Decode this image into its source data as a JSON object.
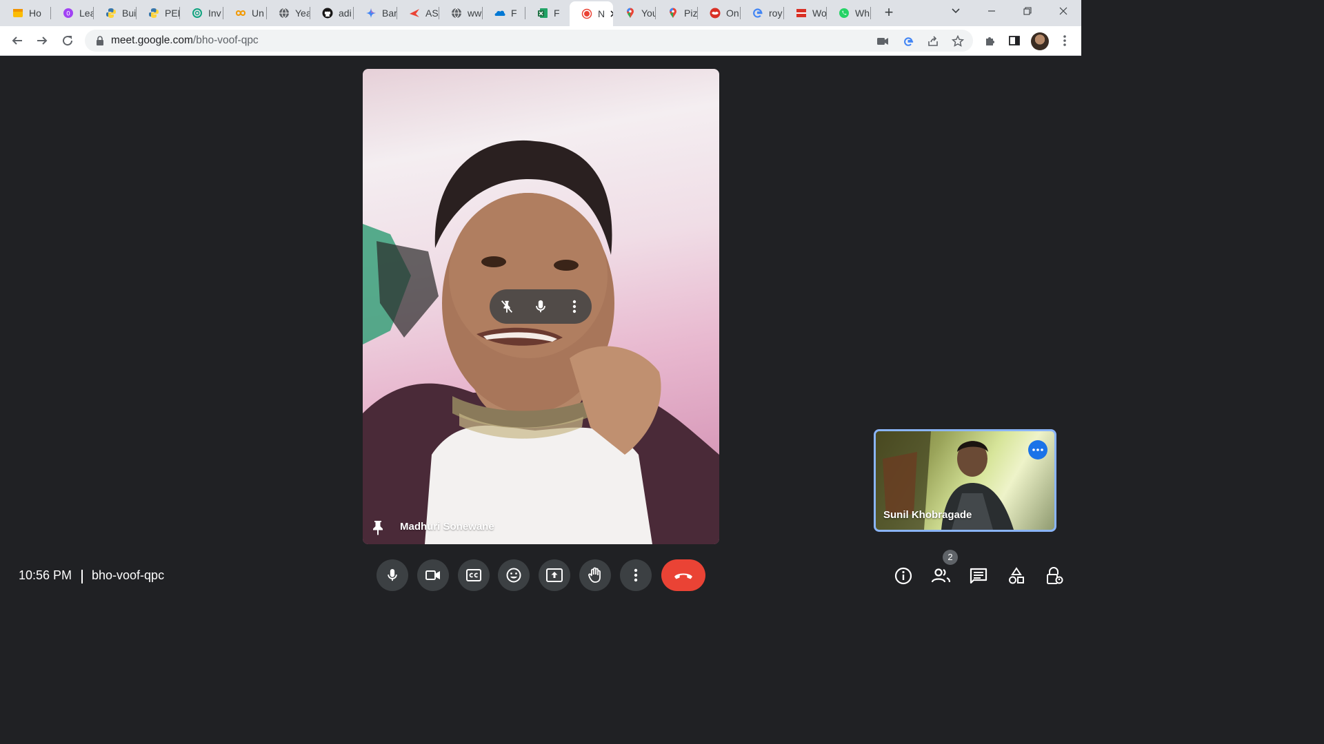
{
  "browser": {
    "tabs": [
      {
        "label": "Ho",
        "icon": "note-icon",
        "color": "#fbbc04"
      },
      {
        "label": "Lea",
        "icon": "leaf-icon",
        "color": "#a142f4"
      },
      {
        "label": "Bui",
        "icon": "python-icon",
        "color": "#3776ab"
      },
      {
        "label": "PEF",
        "icon": "python-icon",
        "color": "#3776ab"
      },
      {
        "label": "Inv",
        "icon": "openai-icon",
        "color": "#10a37f"
      },
      {
        "label": "Un",
        "icon": "infinity-icon",
        "color": "#f29900"
      },
      {
        "label": "Yea",
        "icon": "globe-icon",
        "color": "#5f6368"
      },
      {
        "label": "adi",
        "icon": "github-icon",
        "color": "#181717"
      },
      {
        "label": "Bar",
        "icon": "sparkle-icon",
        "color": "#4285f4"
      },
      {
        "label": "AS",
        "icon": "arrow-red-icon",
        "color": "#ea4335"
      },
      {
        "label": "ww",
        "icon": "globe-icon",
        "color": "#5f6368"
      },
      {
        "label": "F",
        "icon": "onedrive-icon",
        "color": "#0078d4"
      },
      {
        "label": "F",
        "icon": "excel-icon",
        "color": "#1d6f42"
      },
      {
        "label": "N",
        "icon": "recording-icon",
        "color": "#ea4335",
        "active": true
      },
      {
        "label": "You",
        "icon": "maps-pin-icon",
        "color": "#34a853"
      },
      {
        "label": "Piz",
        "icon": "maps-pin-icon",
        "color": "#34a853"
      },
      {
        "label": "On",
        "icon": "lips-icon",
        "color": "#d93025"
      },
      {
        "label": "roy",
        "icon": "google-g-icon",
        "color": "#4285f4"
      },
      {
        "label": "Wo",
        "icon": "flag-icon",
        "color": "#d93025"
      },
      {
        "label": "Wh",
        "icon": "whatsapp-icon",
        "color": "#25d366"
      }
    ],
    "new_tab": "+",
    "url_host": "meet.google.com",
    "url_path": "/bho-voof-qpc"
  },
  "meet": {
    "main_participant": "Madhuri Sonewane",
    "self_participant": "Sunil Khobragade",
    "time": "10:56 PM",
    "meeting_code": "bho-voof-qpc",
    "participant_count": "2",
    "colors": {
      "background": "#202124",
      "button": "#3c4043",
      "end_call": "#ea4335",
      "self_border": "#8ab4f8",
      "accent": "#1a73e8"
    }
  }
}
